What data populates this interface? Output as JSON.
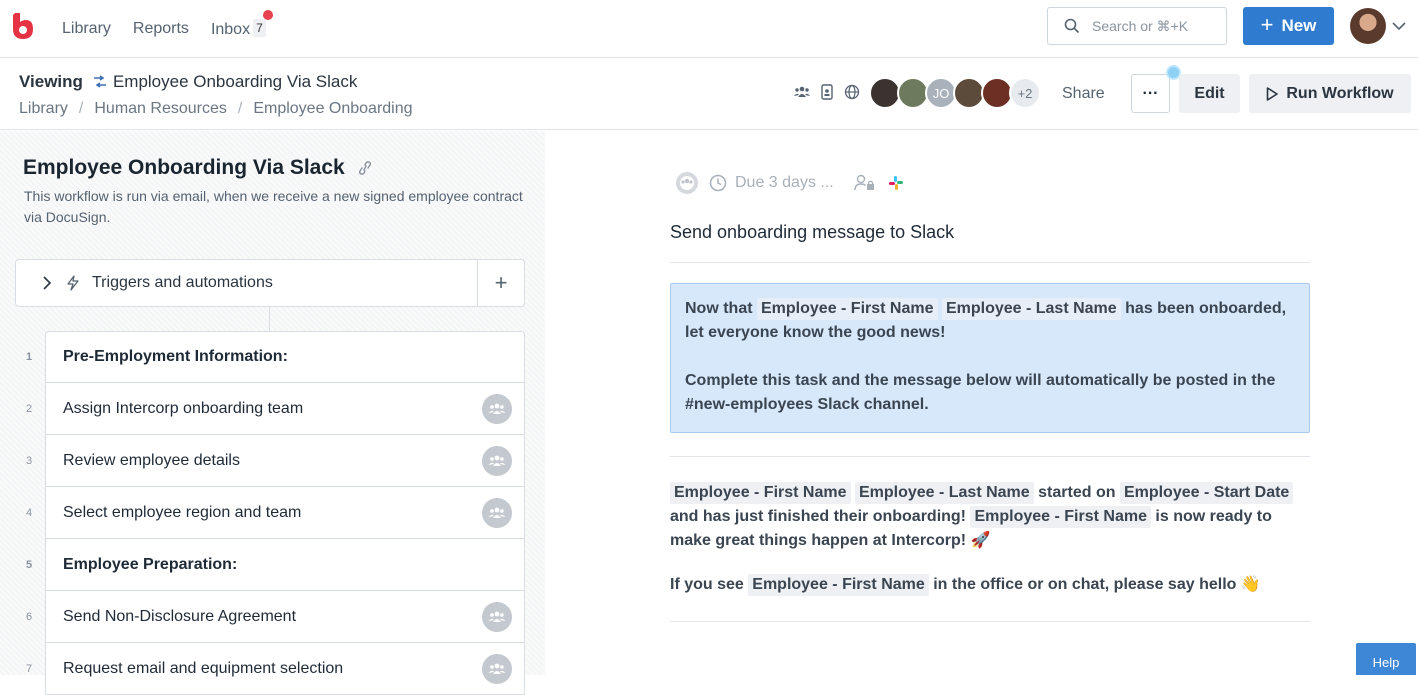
{
  "topbar": {
    "nav": [
      "Library",
      "Reports",
      "Inbox"
    ],
    "inbox_count": "7",
    "search_placeholder": "Search or ⌘+K",
    "new_label": "New",
    "brand_color": "#2f7bd0"
  },
  "subheader": {
    "viewing_label": "Viewing",
    "workflow_name": "Employee Onboarding Via Slack",
    "breadcrumbs": [
      "Library",
      "Human Resources",
      "Employee Onboarding"
    ],
    "avatar_initials": "JO",
    "avatar_more": "+2",
    "share_label": "Share",
    "more_label": "···",
    "edit_label": "Edit",
    "run_label": "Run Workflow"
  },
  "left": {
    "title": "Employee Onboarding Via Slack",
    "description": "This workflow is run via email, when we receive a new signed employee contract via DocuSign.",
    "triggers_label": "Triggers and automations",
    "tasks": [
      {
        "num": "1",
        "label": "Pre-Employment Information:",
        "heading": true
      },
      {
        "num": "2",
        "label": "Assign Intercorp onboarding team",
        "heading": false
      },
      {
        "num": "3",
        "label": "Review employee details",
        "heading": false
      },
      {
        "num": "4",
        "label": "Select employee region and team",
        "heading": false
      },
      {
        "num": "5",
        "label": "Employee Preparation:",
        "heading": true
      },
      {
        "num": "6",
        "label": "Send Non-Disclosure Agreement",
        "heading": false
      },
      {
        "num": "7",
        "label": "Request email and equipment selection",
        "heading": false
      }
    ]
  },
  "right": {
    "due_text": "Due 3 days ...",
    "task_title": "Send onboarding message to Slack",
    "callout": {
      "l1_a": "Now that",
      "var_first": "Employee - First Name",
      "var_last": "Employee - Last Name",
      "l1_b": "has been onboarded, let everyone know the good news!",
      "l2": "Complete this task and the message below will automatically be posted in the #new-employees Slack channel."
    },
    "message": {
      "var_first": "Employee - First Name",
      "var_last": "Employee - Last Name",
      "started_on": "started on",
      "var_start": "Employee - Start Date",
      "finished": "and has just finished their onboarding!",
      "ready": "is now ready to make great things happen at Intercorp! 🚀",
      "if_you_see": "If you see",
      "say_hello": "in the office or on chat, please say hello 👋"
    }
  },
  "help_label": "Help"
}
